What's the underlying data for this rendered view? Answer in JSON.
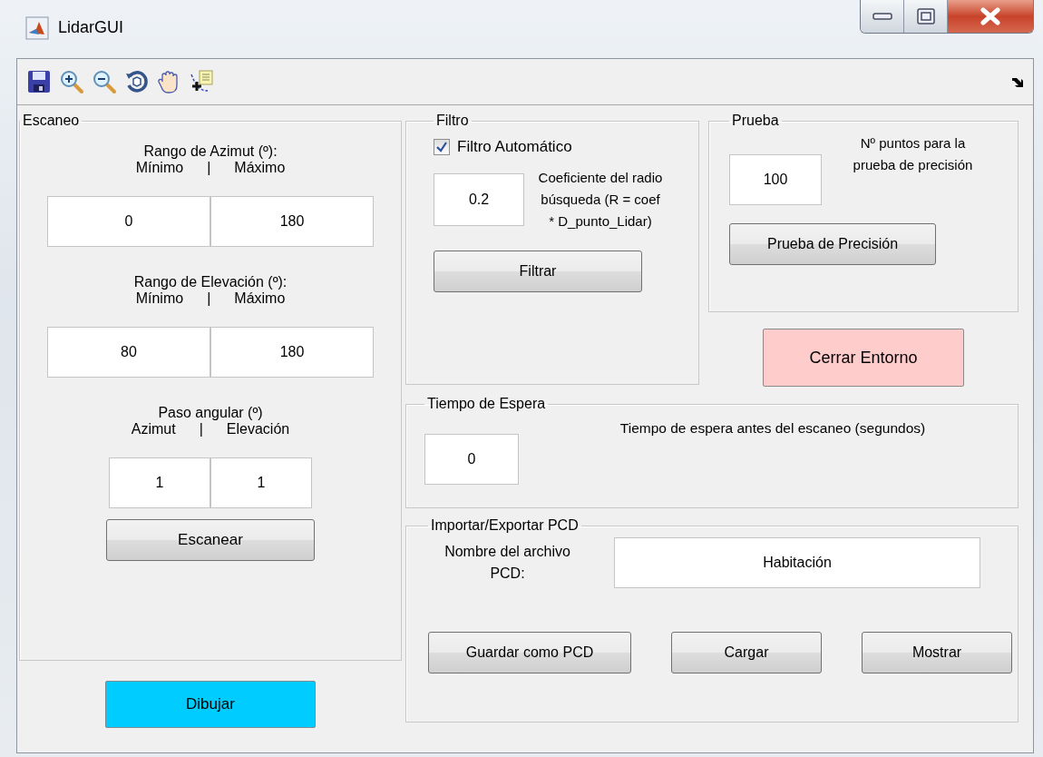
{
  "window": {
    "title": "LidarGUI"
  },
  "toolbar": {
    "tools": [
      {
        "kind": "save"
      },
      {
        "kind": "zoom-in"
      },
      {
        "kind": "zoom-out"
      },
      {
        "kind": "rotate"
      },
      {
        "kind": "pan"
      },
      {
        "kind": "data-cursor"
      }
    ]
  },
  "escaneo": {
    "title": "Escaneo",
    "groups": [
      {
        "heading": "Rango de Azimut (º):",
        "label_left": "Mínimo",
        "separator": "|",
        "label_right": "Máximo",
        "values": [
          "0",
          "180"
        ],
        "kind": "wide"
      },
      {
        "heading": "Rango de Elevación (º):",
        "label_left": "Mínimo",
        "separator": "|",
        "label_right": "Máximo",
        "values": [
          "80",
          "180"
        ],
        "kind": "wide"
      },
      {
        "heading": "Paso angular (º)",
        "label_left": "Azimut",
        "separator": "|",
        "label_right": "Elevación",
        "values": [
          "1",
          "1"
        ],
        "kind": "narrow"
      }
    ],
    "button": "Escanear"
  },
  "draw_button": "Dibujar",
  "filtro": {
    "title": "Filtro",
    "checkbox": {
      "label": "Filtro Automático",
      "checked": true
    },
    "value": "0.2",
    "description": "Coeficiente del radio búsqueda (R = coef * D_punto_Lidar)",
    "button": "Filtrar"
  },
  "prueba": {
    "title": "Prueba",
    "value": "100",
    "description": "Nº puntos para la prueba de precisión",
    "button": "Prueba de Precisión"
  },
  "close_button": "Cerrar Entorno",
  "tiempo": {
    "title": "Tiempo de Espera",
    "value": "0",
    "description": "Tiempo de espera antes del escaneo (segundos)"
  },
  "pcd": {
    "title": "Importar/Exportar PCD",
    "label": "Nombre del archivo PCD:",
    "value": "Habitación",
    "buttons": [
      "Guardar como PCD",
      "Cargar",
      "Mostrar"
    ]
  }
}
